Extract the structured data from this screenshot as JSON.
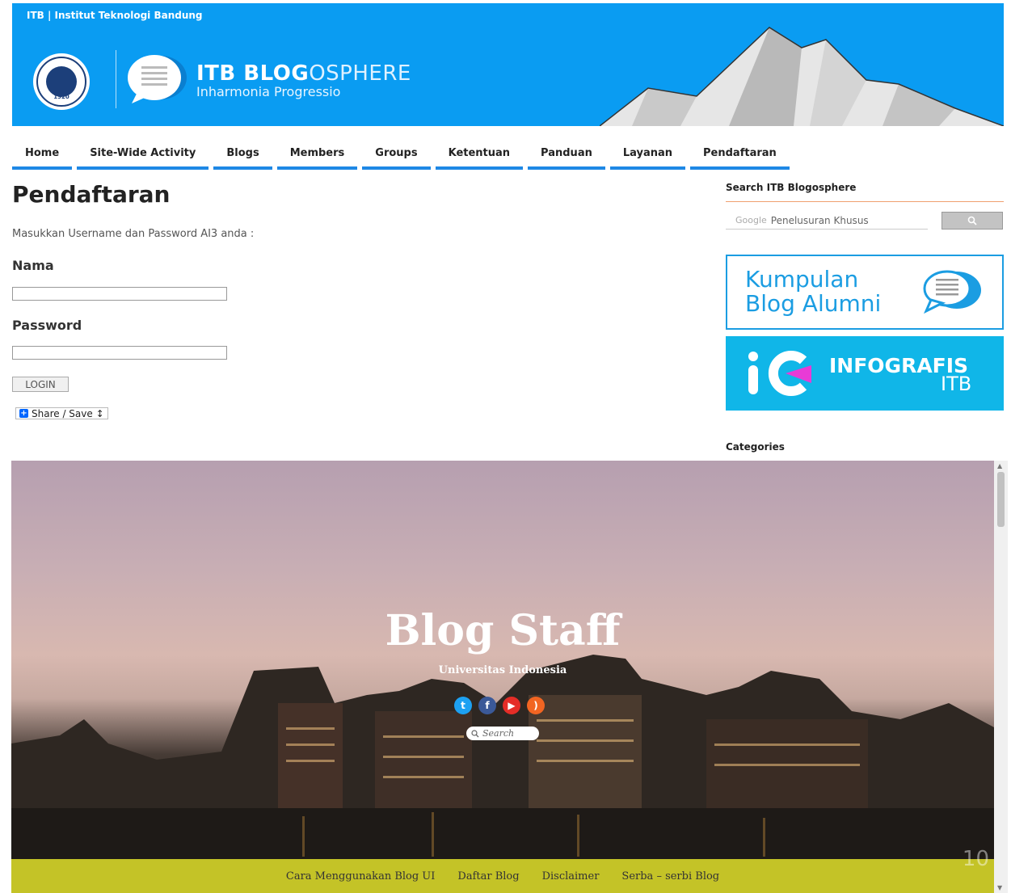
{
  "header": {
    "institute_link": "ITB | Institut Teknologi Bandung",
    "seal_year": "1920",
    "brand_bold": "ITB BLOG",
    "brand_light": "OSPHERE",
    "tagline": "Inharmonia Progressio"
  },
  "nav": [
    "Home",
    "Site-Wide Activity",
    "Blogs",
    "Members",
    "Groups",
    "Ketentuan",
    "Panduan",
    "Layanan",
    "Pendaftaran"
  ],
  "main": {
    "title": "Pendaftaran",
    "intro": "Masukkan Username dan Password AI3 anda :",
    "name_label": "Nama",
    "password_label": "Password",
    "login_label": "LOGIN",
    "share_label": "Share / Save ↕"
  },
  "sidebar": {
    "search_heading": "Search ITB Blogosphere",
    "google_label": "Google",
    "search_placeholder": "Penelusuran Khusus",
    "alumni_banner": "Kumpulan\nBlog Alumni",
    "info_banner_main": "INFOGRAFIS",
    "info_banner_sub": "ITB",
    "categories_heading": "Categories"
  },
  "embed": {
    "title": "Blog Staff",
    "subtitle": "Universitas Indonesia",
    "search_placeholder": "Search",
    "footer_links": [
      "Cara Menggunakan Blog UI",
      "Daftar Blog",
      "Disclaimer",
      "Serba – serbi Blog"
    ],
    "page_number": "10",
    "social_icons": [
      "twitter-icon",
      "facebook-icon",
      "youtube-icon",
      "rss-icon"
    ]
  },
  "colors": {
    "header_blue": "#0a9cf2",
    "nav_underline": "#1e88e5",
    "footer_bar": "#c4c327",
    "infografis_bg": "#10b6e8"
  }
}
